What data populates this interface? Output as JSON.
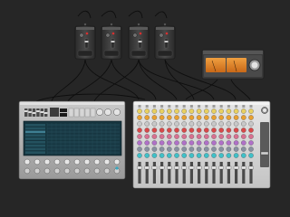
{
  "canvas": {
    "background": "#262626"
  },
  "colors": {
    "cable": "#0e0e0e",
    "pedal_body": "#3a3a3a",
    "pedal_led": "#d83030",
    "vu_face": "#d9822b",
    "synth_screen": "#16353f",
    "mixer_body": "#d9d9d9",
    "knob_rows": [
      "#e8d060",
      "#e8a030",
      "#c8c8c8",
      "#d84848",
      "#d87090",
      "#b070c8",
      "#8890a0",
      "#40c0c8"
    ]
  },
  "synth": {
    "title": "",
    "header_text": "",
    "screen_rows": [
      "",
      "",
      "",
      "",
      "",
      "",
      "",
      "",
      ""
    ]
  },
  "mixer": {
    "channel_count": 16
  },
  "pedals": [
    {
      "name": "pedal-1"
    },
    {
      "name": "pedal-2"
    },
    {
      "name": "pedal-3"
    },
    {
      "name": "pedal-4"
    }
  ],
  "vu_meter": {
    "meters": 2
  }
}
